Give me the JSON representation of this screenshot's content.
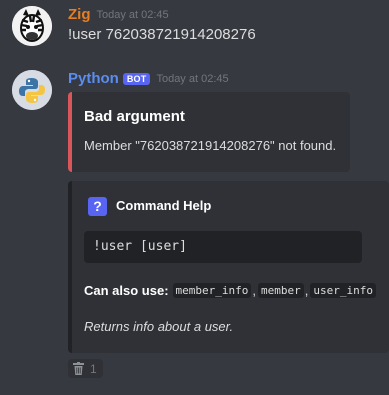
{
  "messages": [
    {
      "username": "Zig",
      "username_color": "#e67e22",
      "timestamp": "Today at 02:45",
      "content": "!user 762038721914208276",
      "avatar": "zebra-avatar"
    },
    {
      "username": "Python",
      "username_color": "#5b8def",
      "bot_tag": "BOT",
      "timestamp": "Today at 02:45",
      "avatar": "python-logo-avatar",
      "error_embed": {
        "title": "Bad argument",
        "description": "Member \"762038721914208276\" not found.",
        "accent_color": "#d9575b"
      },
      "help_embed": {
        "icon": "question-mark-icon",
        "title": "Command Help",
        "usage": "!user [user]",
        "aliases_label": "Can also use:",
        "aliases": [
          "member_info",
          "member",
          "user_info"
        ],
        "description": "Returns info about a user."
      },
      "reaction": {
        "icon": "wastebasket-icon",
        "count": "1"
      }
    }
  ]
}
